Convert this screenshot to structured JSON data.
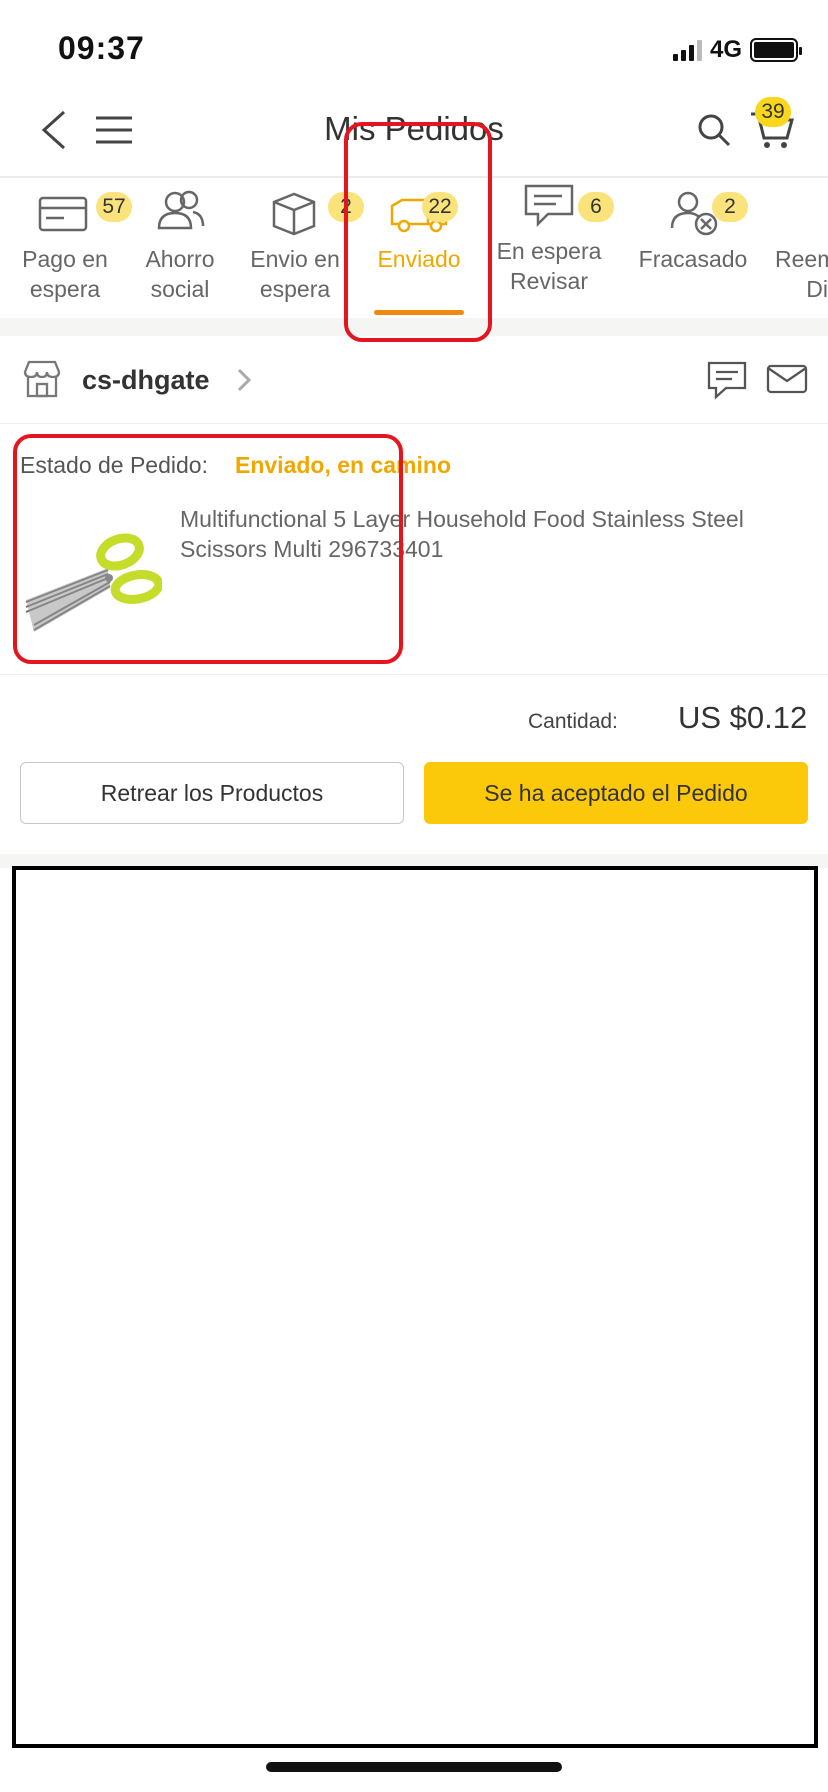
{
  "status_bar": {
    "time": "09:37",
    "network": "4G"
  },
  "header": {
    "title": "Mis Pedidos",
    "cart_count": "39"
  },
  "tabs": [
    {
      "label": "Pago en\nespera",
      "badge": "57",
      "icon": "payment-card-icon"
    },
    {
      "label": "Ahorro\nsocial",
      "badge": "",
      "icon": "group-people-icon"
    },
    {
      "label": "Envio en\nespera",
      "badge": "2",
      "icon": "box-icon"
    },
    {
      "label": "Enviado",
      "badge": "22",
      "icon": "truck-icon",
      "active": true
    },
    {
      "label": "En espera\nRevisar",
      "badge": "6",
      "icon": "review-chat-icon"
    },
    {
      "label": "Fracasado",
      "badge": "2",
      "icon": "user-failed-icon"
    },
    {
      "label": "Reem\nDi",
      "badge": "",
      "icon": ""
    }
  ],
  "order": {
    "shop_name": "cs-dhgate",
    "status_label": "Estado de Pedido:",
    "status_value": "Enviado, en camino",
    "product_name": "Multifunctional 5 Layer Household Food Stainless Steel Scissors Multi 296733401",
    "quantity_label": "Cantidad:",
    "price": "US $0.12",
    "buttons": {
      "secondary": "Retrear los Productos",
      "primary": "Se ha aceptado el Pedido"
    }
  },
  "colors": {
    "accent": "#f0a800",
    "primary_button": "#fcc80a",
    "highlight": "#e5141e"
  }
}
